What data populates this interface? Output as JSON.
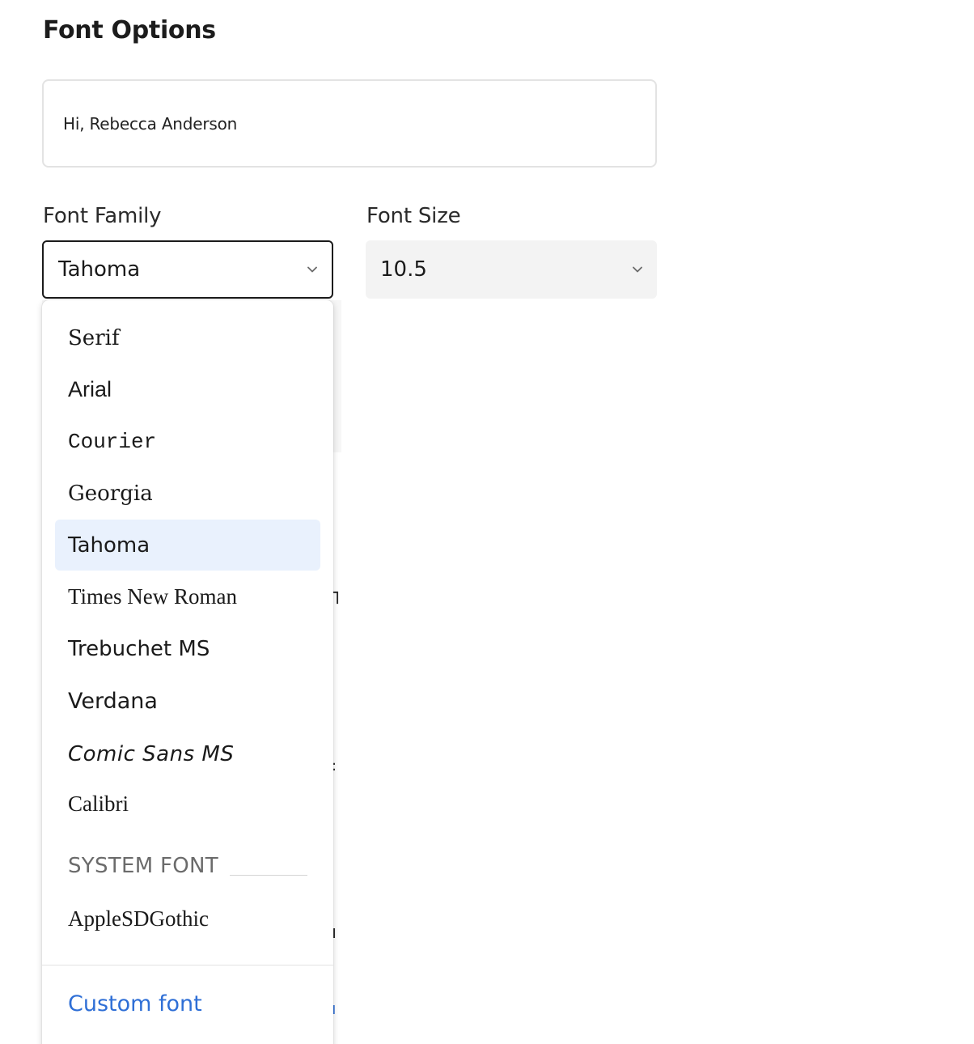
{
  "header": {
    "title": "Font Options"
  },
  "preview": {
    "text": "Hi, Rebecca Anderson"
  },
  "font_family": {
    "label": "Font Family",
    "selected": "Tahoma"
  },
  "font_size": {
    "label": "Font Size",
    "selected": "10.5"
  },
  "dropdown": {
    "options": [
      "Serif",
      "Arial",
      "Courier",
      "Georgia",
      "Tahoma",
      "Times New Roman",
      "Trebuchet MS",
      "Verdana",
      "Comic Sans MS",
      "Calibri"
    ],
    "selected_option": "Tahoma",
    "system_group_label": "SYSTEM FONT",
    "system_options": [
      "AppleSDGothic"
    ],
    "custom_font_label": "Custom font"
  },
  "colors": {
    "accent_link": "#2f6fd6",
    "selected_bg": "#e9f1fd",
    "size_select_bg": "#f3f3f3"
  },
  "icons": {
    "select_chevron": "chevron-down-icon"
  }
}
